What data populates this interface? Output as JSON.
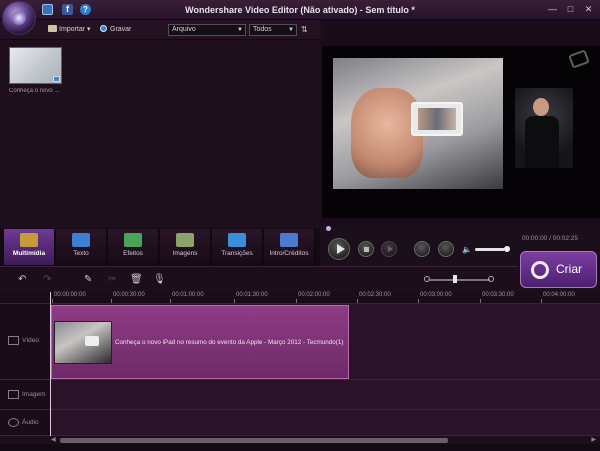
{
  "window": {
    "title": "Wondershare Video Editor (Não ativado) - Sem título *",
    "buttons": {
      "minimize": "—",
      "maximize": "□",
      "close": "✕"
    }
  },
  "quick_icons": {
    "facebook": "f",
    "help": "?"
  },
  "library_toolbar": {
    "import_label": "Importar",
    "record_label": "Gravar",
    "filter_value": "Arquivo",
    "sort_value": "Todos"
  },
  "library": {
    "items": [
      {
        "label": "Conheça o novo ..."
      }
    ]
  },
  "tabs": [
    {
      "label": "Multimídia",
      "color": "#c79a3a"
    },
    {
      "label": "Texto",
      "color": "#3d7fd0"
    },
    {
      "label": "Efeitos",
      "color": "#4aa55a"
    },
    {
      "label": "Imagens",
      "color": "#8aa36a"
    },
    {
      "label": "Transições",
      "color": "#3b8fd8"
    },
    {
      "label": "Intro/Créditos",
      "color": "#4c7ad1"
    }
  ],
  "player": {
    "time_display": "00:00:00 / 00:02:25",
    "volume_level": 0.85
  },
  "create_button": {
    "label": "Criar"
  },
  "timeline": {
    "ruler": [
      "00:00:00:00",
      "00:00:30:00",
      "00:01:00:00",
      "00:01:30:00",
      "00:02:00:00",
      "00:02:30:00",
      "00:03:00:00",
      "00:03:30:00",
      "00:04:00:00"
    ],
    "tracks": [
      {
        "name": "Vídeo"
      },
      {
        "name": "Imagem"
      },
      {
        "name": "Áudio"
      }
    ],
    "clip": {
      "label": "Conheça o novo iPad no resumo do evento da Apple - Março 2012 - Tecmundo(1)"
    }
  }
}
